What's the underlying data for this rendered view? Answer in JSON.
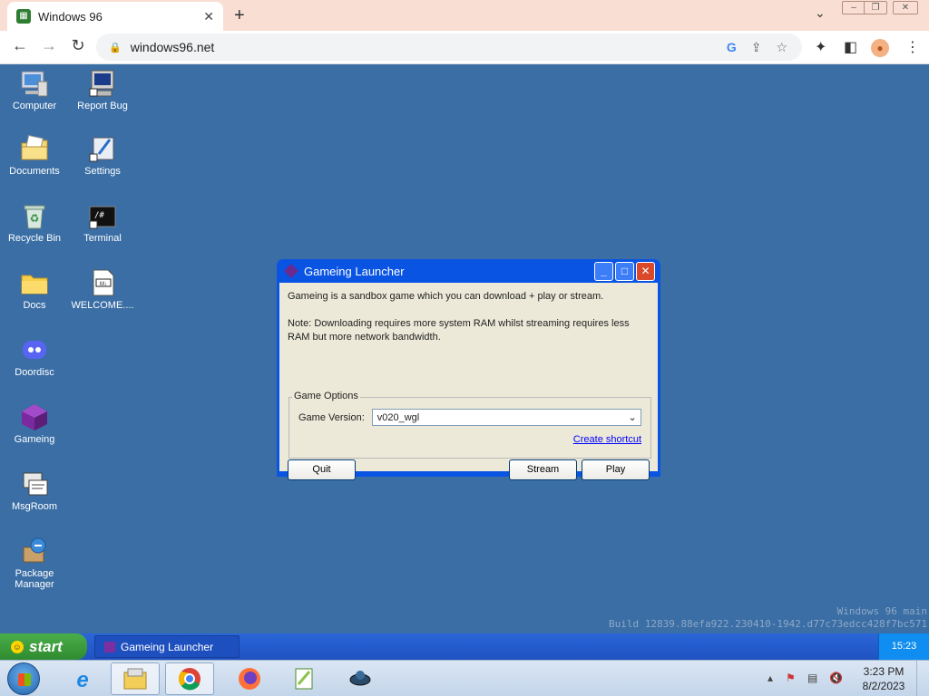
{
  "browser": {
    "tab_title": "Windows 96",
    "url": "windows96.net",
    "new_tab_glyph": "+",
    "tab_close_glyph": "✕"
  },
  "desktop": {
    "icons_col1": [
      {
        "label": "Computer",
        "icon": "computer-icon"
      },
      {
        "label": "Documents",
        "icon": "documents-icon"
      },
      {
        "label": "Recycle Bin",
        "icon": "recycle-bin-icon"
      },
      {
        "label": "Docs",
        "icon": "folder-icon"
      },
      {
        "label": "Doordisc",
        "icon": "discord-icon"
      },
      {
        "label": "Gameing",
        "icon": "gameing-icon"
      },
      {
        "label": "MsgRoom",
        "icon": "msgroom-icon"
      },
      {
        "label": "Package Manager",
        "icon": "package-manager-icon"
      }
    ],
    "icons_col2": [
      {
        "label": "Report Bug",
        "icon": "report-bug-icon"
      },
      {
        "label": "Settings",
        "icon": "settings-icon"
      },
      {
        "label": "Terminal",
        "icon": "terminal-icon"
      },
      {
        "label": "WELCOME....",
        "icon": "markdown-file-icon"
      }
    ],
    "watermark_line1": "Windows 96 main",
    "watermark_line2": "Build 12839.88efa922.230410-1942.d77c73edcc428f7bc571"
  },
  "dialog": {
    "title": "Gameing Launcher",
    "description": "Gameing is a sandbox game which you can download + play or stream.",
    "note": "Note: Downloading requires more system RAM whilst streaming requires less RAM but more network bandwidth.",
    "group_label": "Game Options",
    "version_label": "Game Version:",
    "version_value": "v020_wgl",
    "shortcut_link": "Create shortcut",
    "quit_label": "Quit",
    "stream_label": "Stream",
    "play_label": "Play"
  },
  "taskbar96": {
    "start_label": "start",
    "task_label": "Gameing Launcher",
    "clock": "15:23"
  },
  "taskbar7": {
    "time": "3:23 PM",
    "date": "8/2/2023"
  }
}
